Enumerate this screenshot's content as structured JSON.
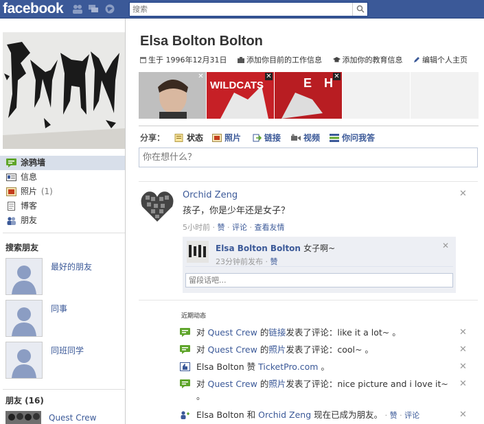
{
  "header": {
    "logo": "facebook",
    "search_placeholder": "搜索"
  },
  "colors": {
    "brand_blue": "#3b5998",
    "nav_active_bg": "#d8dfea",
    "comment_bg": "#edeff4"
  },
  "sidebar": {
    "nav": [
      {
        "label": "涂鸦墙",
        "icon": "wall-icon"
      },
      {
        "label": "信息",
        "icon": "info-icon"
      },
      {
        "label": "照片",
        "count": "(1)",
        "icon": "photos-icon"
      },
      {
        "label": "博客",
        "icon": "notes-icon"
      },
      {
        "label": "朋友",
        "icon": "friends-icon"
      }
    ],
    "search_friends_title": "搜索朋友",
    "friend_suggestions": [
      {
        "label": "最好的朋友"
      },
      {
        "label": "同事"
      },
      {
        "label": "同班同学"
      }
    ],
    "friends_title": "朋友 (16)",
    "friend_preview_name": "Quest Crew"
  },
  "profile": {
    "name": "Elsa Bolton Bolton",
    "birthday": "生于 1996年12月31日",
    "add_work": "添加你目前的工作信息",
    "add_education": "添加你的教育信息",
    "edit_profile": "编辑个人主页"
  },
  "share": {
    "label": "分享：",
    "items": [
      "状态",
      "照片",
      "链接",
      "视频",
      "你问我答"
    ],
    "composer_placeholder": "你在想什么？"
  },
  "story": {
    "author": "Orchid Zeng",
    "text": "孩子，你是少年还是女子？",
    "time": "5小时前",
    "like": "赞",
    "comment": "评论",
    "view_friendship": "查看友情",
    "comment_item": {
      "author": "Elsa Bolton Bolton",
      "text": "女子啊~",
      "time": "23分钟前发布",
      "like": "赞"
    },
    "comment_placeholder": "留段话吧..."
  },
  "recent": {
    "title": "近期动态",
    "items": [
      {
        "pre": "对 ",
        "actor": "Quest Crew",
        "mid1": " 的",
        "obj": "链接",
        "post": "发表了评论：like it a lot~ 。"
      },
      {
        "pre": "对 ",
        "actor": "Quest Crew",
        "mid1": " 的",
        "obj": "照片",
        "post": "发表了评论：cool~ 。"
      },
      {
        "pre": "Elsa Bolton 赞 ",
        "actor": "TicketPro.com",
        "mid1": " 。",
        "obj": "",
        "post": ""
      },
      {
        "pre": "对 ",
        "actor": "Quest Crew",
        "mid1": " 的",
        "obj": "照片",
        "post": "发表了评论：nice picture and i love it~ 。"
      },
      {
        "pre": "Elsa Bolton 和 ",
        "actor": "Orchid Zeng",
        "mid1": " 现在已成为朋友。",
        "obj": "",
        "post": "",
        "like": "赞",
        "comment": "评论"
      }
    ]
  }
}
